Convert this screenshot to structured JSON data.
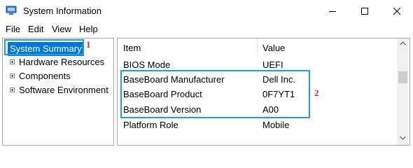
{
  "window": {
    "title": "System Information"
  },
  "menu": [
    {
      "label": "File"
    },
    {
      "label": "Edit"
    },
    {
      "label": "View"
    },
    {
      "label": "Help"
    }
  ],
  "tree": {
    "root": "System Summary",
    "children": [
      {
        "label": "Hardware Resources"
      },
      {
        "label": "Components"
      },
      {
        "label": "Software Environment"
      }
    ]
  },
  "annotations": {
    "tag1": "1",
    "tag2": "2",
    "color": "#1f9ede",
    "tag_color": "#d9252b"
  },
  "table": {
    "headers": {
      "item": "Item",
      "value": "Value"
    },
    "rows": [
      {
        "item": "BIOS Mode",
        "value": "UEFI"
      },
      {
        "item": "BaseBoard Manufacturer",
        "value": "Dell Inc."
      },
      {
        "item": "BaseBoard Product",
        "value": "0F7YT1"
      },
      {
        "item": "BaseBoard Version",
        "value": "A00"
      },
      {
        "item": "Platform Role",
        "value": "Mobile"
      }
    ]
  },
  "colors": {
    "selection": "#0078d7",
    "border": "#a7a7a7"
  },
  "icons": {
    "app": "system-information-app-icon",
    "minimize": "minimize-icon",
    "maximize": "maximize-icon",
    "close": "close-icon",
    "expand": "plus-expander-icon"
  }
}
